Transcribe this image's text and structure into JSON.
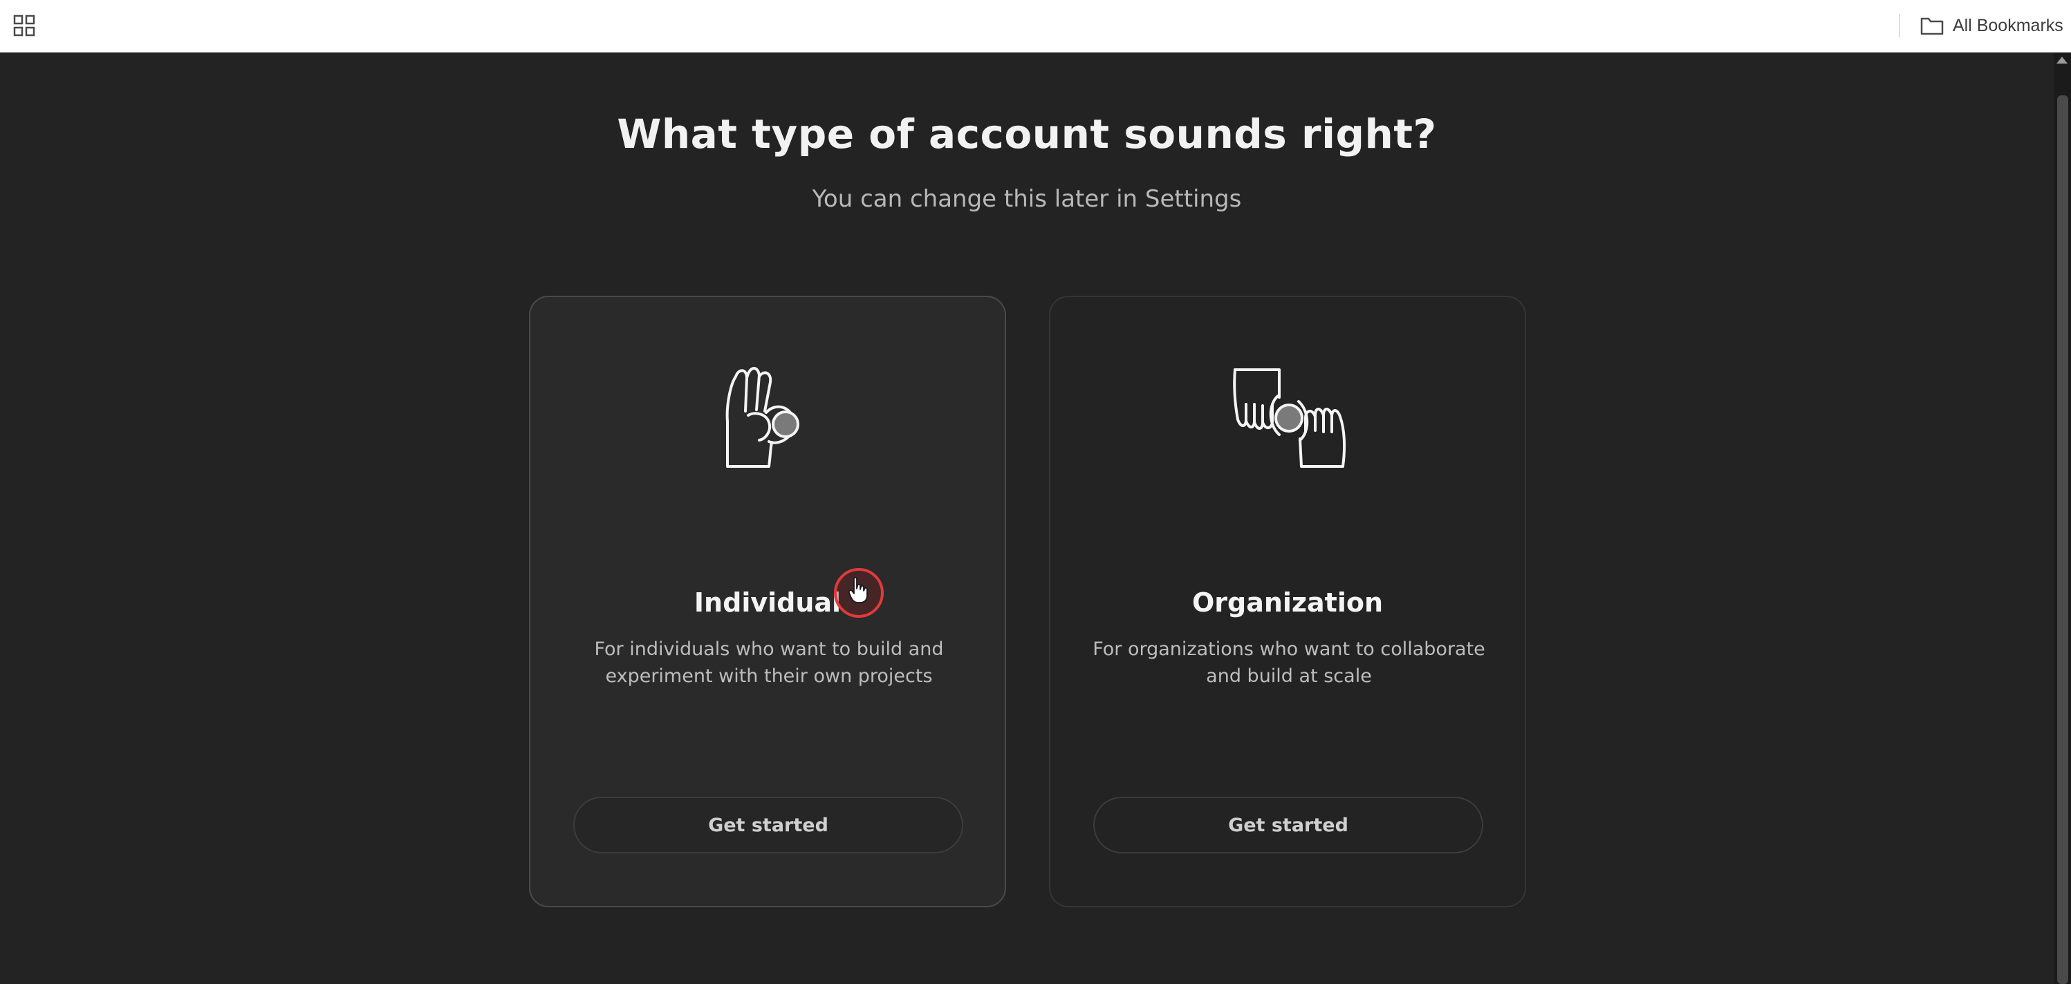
{
  "browser": {
    "bookmarks_label": "All Bookmarks",
    "icons": {
      "apps": "apps-grid-icon",
      "bookmarks": "folder-icon"
    }
  },
  "page": {
    "heading": "What type of account sounds right?",
    "subheading": "You can change this later in Settings",
    "cards": [
      {
        "id": "individual",
        "title": "Individual",
        "description": "For individuals who want to build and experiment with their own projects",
        "button_label": "Get started",
        "icon": "hand-ok-icon"
      },
      {
        "id": "organization",
        "title": "Organization",
        "description": "For organizations who want to collaborate and build at scale",
        "button_label": "Get started",
        "icon": "hands-handoff-icon"
      }
    ]
  },
  "colors": {
    "background": "#232323",
    "card_hover_background": "#2a2a2a",
    "text_primary": "#f2f2f2",
    "text_secondary": "#b8b8b8",
    "cursor_ring": "#e03a3a"
  }
}
